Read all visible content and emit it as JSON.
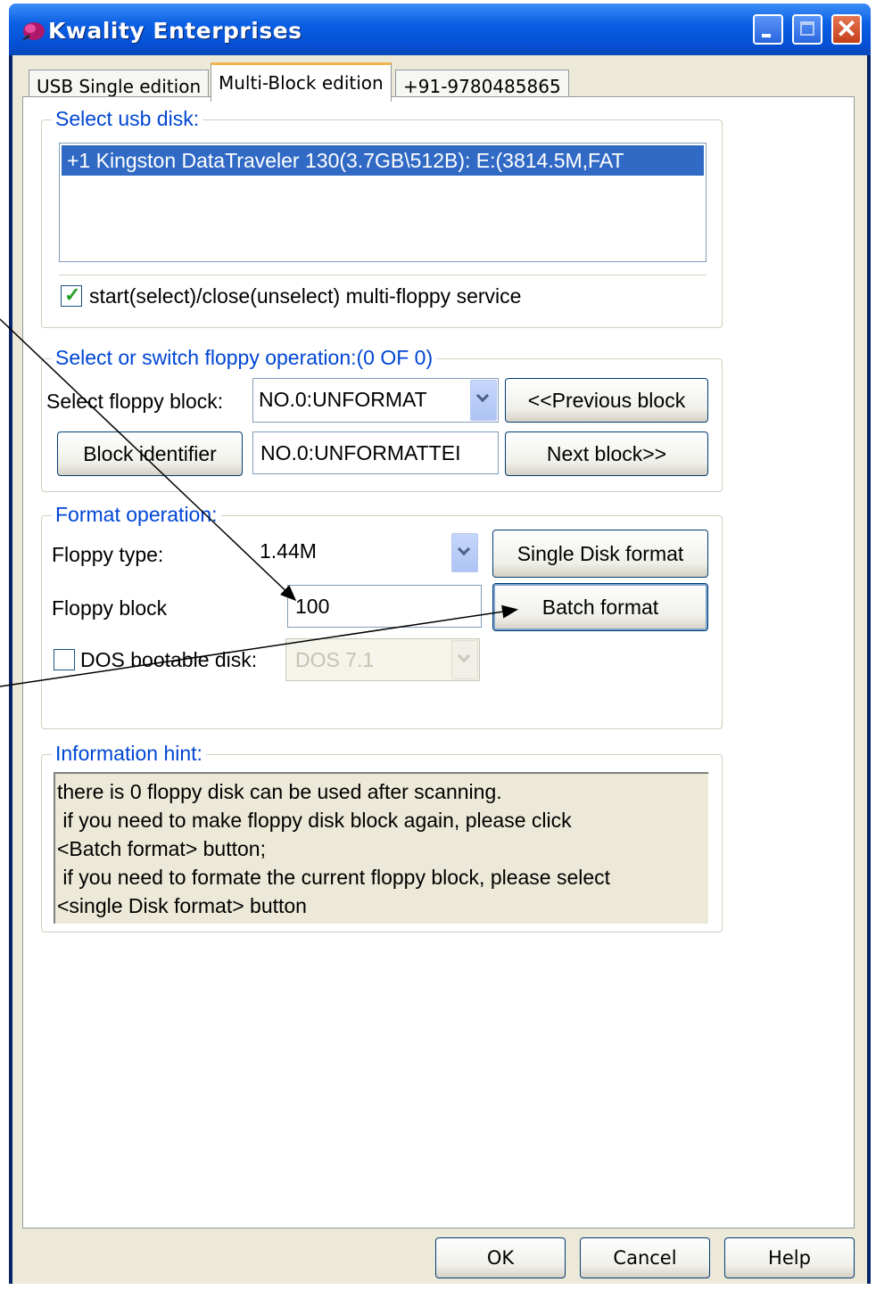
{
  "window": {
    "title": "Kwality Enterprises"
  },
  "tabs": [
    {
      "label": "USB Single edition"
    },
    {
      "label": "Multi-Block edition"
    },
    {
      "label": "+91-9780485865"
    }
  ],
  "usb_group": {
    "legend": "Select usb disk:",
    "selected_disk": "+1 Kingston DataTraveler 130(3.7GB\\512B): E:(3814.5M,FAT",
    "service_checkbox_label": "start(select)/close(unselect) multi-floppy service",
    "service_checked": true
  },
  "switch_group": {
    "legend": "Select or switch floppy operation:(0 OF 0)",
    "select_block_label": "Select floppy block:",
    "select_block_value": "NO.0:UNFORMAT",
    "previous_button": "<<Previous block",
    "identifier_button": "Block identifier",
    "identifier_value": "NO.0:UNFORMATTEI",
    "next_button": "Next block>>"
  },
  "format_group": {
    "legend": "Format operation:",
    "floppy_type_label": "Floppy type:",
    "floppy_type_value": "1.44M",
    "single_format_button": "Single Disk format",
    "floppy_block_label": "Floppy block",
    "floppy_block_value": "100",
    "batch_format_button": "Batch format",
    "dos_checkbox_label": "DOS bootable disk:",
    "dos_checked": false,
    "dos_version_value": "DOS 7.1"
  },
  "hint_group": {
    "legend": "Information hint:",
    "lines": [
      "there is 0 floppy disk can be used after scanning.",
      " if you need to make floppy disk block again, please click",
      "<Batch format> button;",
      " if you need to formate the current floppy block, please select",
      "<single Disk format> button"
    ]
  },
  "footer": {
    "ok_button": "OK",
    "cancel_button": "Cancel",
    "help_button": "Help"
  },
  "colors": {
    "accent": "#0046d5",
    "selection": "#316ac5",
    "titlebar": "#0a5fe3",
    "dialog_bg": "#ece9d8"
  }
}
